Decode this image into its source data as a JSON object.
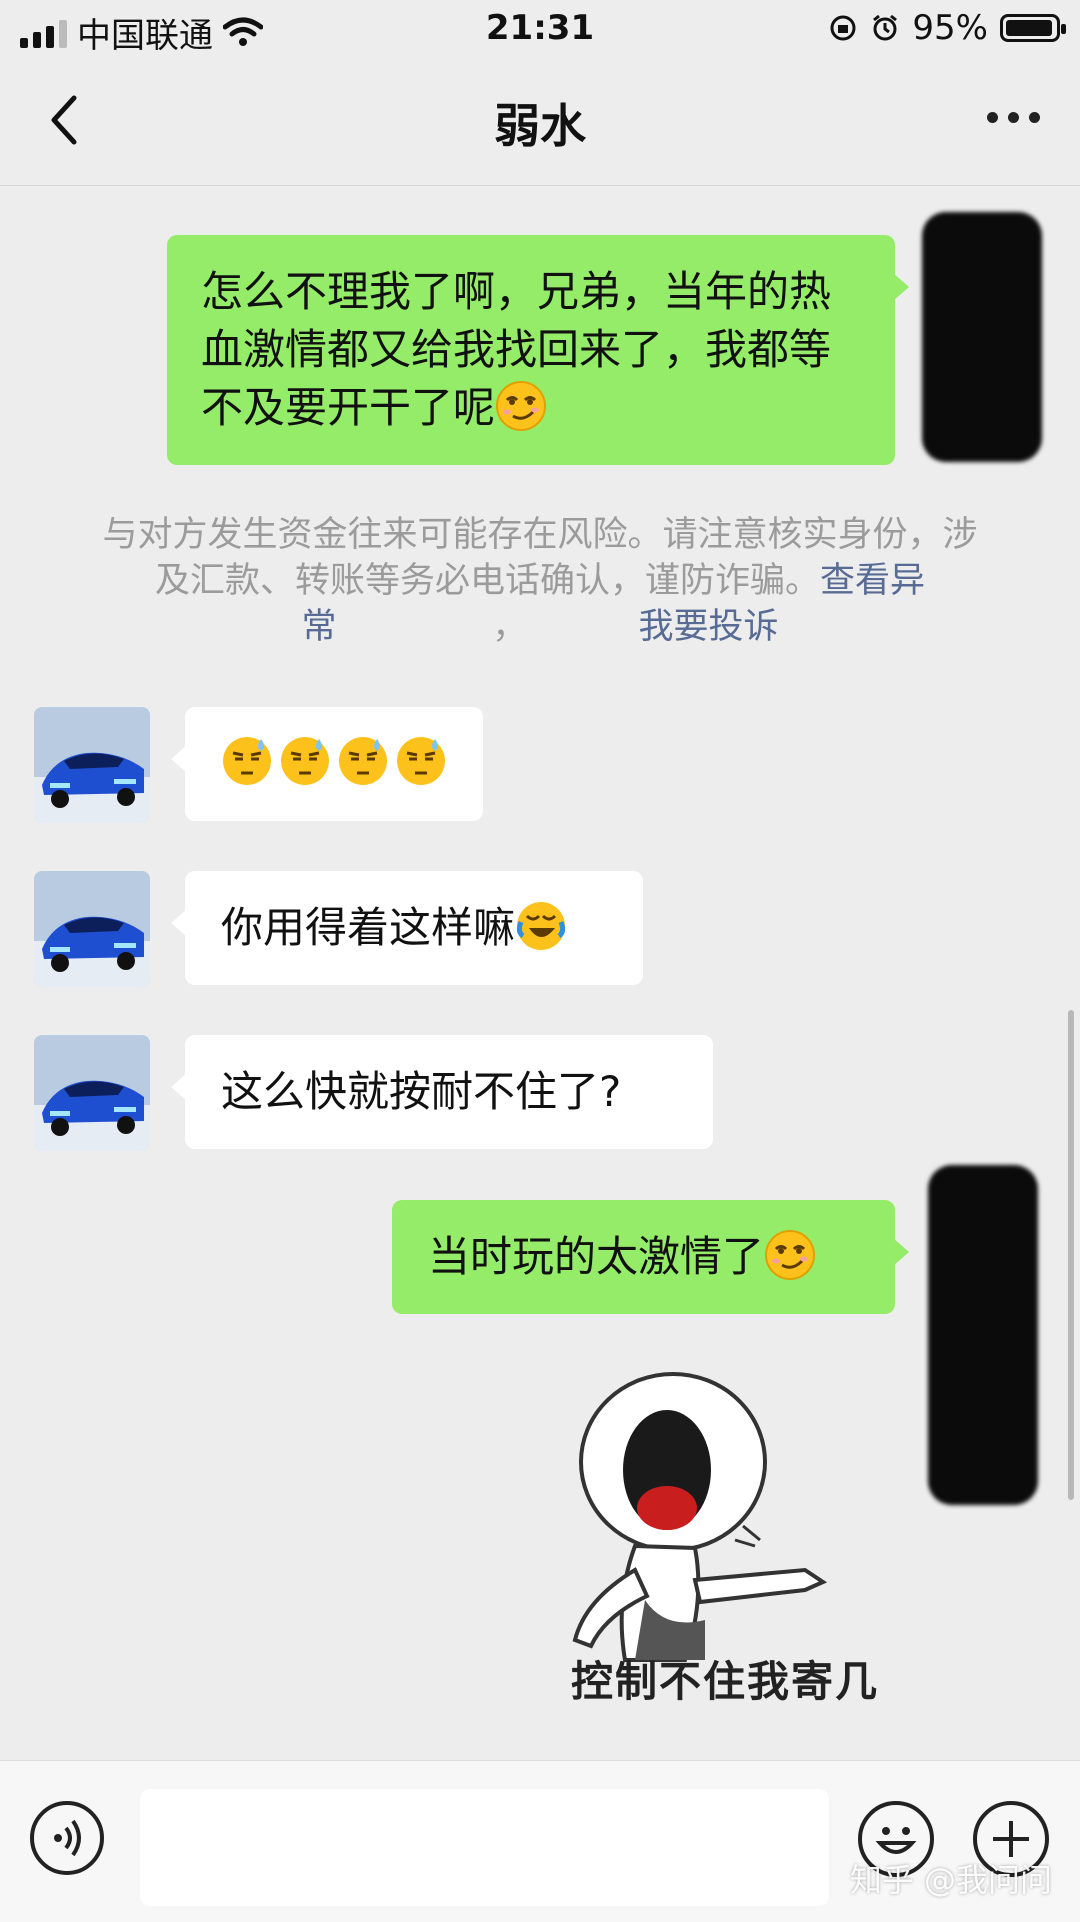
{
  "status_bar": {
    "carrier": "中国联通",
    "time": "21:31",
    "battery": "95%",
    "battery_level": 0.95
  },
  "nav": {
    "title": "弱水",
    "back_icon": "chevron-left-icon",
    "more_icon": "more-dots-icon"
  },
  "messages": [
    {
      "side": "me",
      "text": "怎么不理我了啊，兄弟，当年的热血激情都又给我找回来了，我都等不及要开干了呢",
      "emoji": "smirk-face"
    },
    {
      "side": "other",
      "text": "",
      "emoji": "sweat-face ×4"
    },
    {
      "side": "other",
      "text": "你用得着这样嘛",
      "emoji": "rolling-laugh-face"
    },
    {
      "side": "other",
      "text": "这么快就按耐不住了?"
    },
    {
      "side": "me",
      "text": "当时玩的太激情了",
      "emoji": "smirk-face"
    }
  ],
  "notice": {
    "text": "与对方发生资金往来可能存在风险。请注意核实身份，涉及汇款、转账等务必电话确认，谨防诈骗。",
    "link_view": "查看异常",
    "separator": "，",
    "link_report": "我要投诉"
  },
  "sticker": {
    "caption": "控制不住我寄几"
  },
  "input_bar": {
    "placeholder": "",
    "icons": [
      "voice-icon",
      "emoji-icon",
      "plus-icon"
    ]
  },
  "watermark": "知乎 @我问问",
  "colors": {
    "my_bubble": "#95ec69",
    "other_bubble": "#ffffff",
    "link": "#576b95",
    "background": "#ededed"
  }
}
